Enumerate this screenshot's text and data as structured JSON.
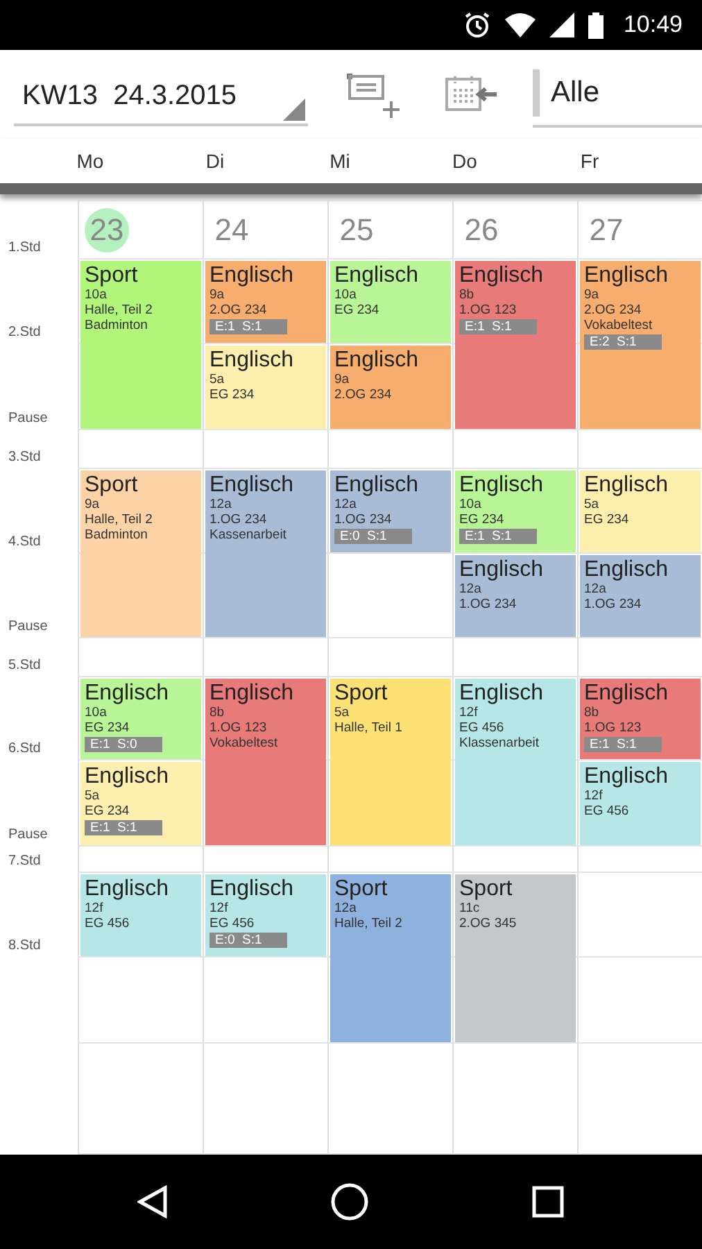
{
  "status_bar": {
    "time": "10:49"
  },
  "toolbar": {
    "week_picker": "KW13  24.3.2015",
    "filter": "Alle"
  },
  "times": [
    "1.Std",
    "2.Std",
    "Pause",
    "3.Std",
    "4.Std",
    "Pause",
    "5.Std",
    "6.Std",
    "Pause",
    "7.Std",
    "8.Std"
  ],
  "days": [
    {
      "weekday": "Mo",
      "date": "23",
      "today": true,
      "slots": [
        {
          "kind": "lesson",
          "subject": "Sport",
          "details": [
            "10a",
            "Halle, Teil 2",
            "Badminton"
          ],
          "color": "#b1f57a"
        },
        {
          "kind": "continued"
        },
        {
          "kind": "lesson",
          "subject": "Sport",
          "details": [
            "9a",
            "Halle, Teil 2",
            "Badminton"
          ],
          "color": "#fbd3a6"
        },
        {
          "kind": "continued"
        },
        {
          "kind": "lesson",
          "subject": "Englisch",
          "details": [
            "10a",
            "EG 234"
          ],
          "badge": "E:1  S:0",
          "color": "#b9f596"
        },
        {
          "kind": "lesson",
          "subject": "Englisch",
          "details": [
            "5a",
            "EG 234"
          ],
          "badge": "E:1  S:1",
          "color": "#fcefad"
        },
        {
          "kind": "lesson",
          "subject": "Englisch",
          "details": [
            "12f",
            "EG 456"
          ],
          "color": "#b6e7e6"
        },
        {
          "kind": "free"
        }
      ]
    },
    {
      "weekday": "Di",
      "date": "24",
      "today": false,
      "slots": [
        {
          "kind": "lesson",
          "subject": "Englisch",
          "details": [
            "9a",
            "2.OG 234"
          ],
          "badge": "E:1  S:1",
          "color": "#f6ad6d"
        },
        {
          "kind": "lesson",
          "subject": "Englisch",
          "details": [
            "5a",
            "EG 234"
          ],
          "color": "#fcefad"
        },
        {
          "kind": "lesson",
          "subject": "Englisch",
          "details": [
            "12a",
            "1.OG 234",
            "Kassenarbeit"
          ],
          "color": "#a8bcd6"
        },
        {
          "kind": "continued"
        },
        {
          "kind": "lesson",
          "subject": "Englisch",
          "details": [
            "8b",
            "1.OG 123",
            "Vokabeltest"
          ],
          "color": "#e87a7a"
        },
        {
          "kind": "continued"
        },
        {
          "kind": "lesson",
          "subject": "Englisch",
          "details": [
            "12f",
            "EG 456"
          ],
          "badge": "E:0  S:1",
          "color": "#b6e7e6"
        },
        {
          "kind": "free"
        }
      ]
    },
    {
      "weekday": "Mi",
      "date": "25",
      "today": false,
      "slots": [
        {
          "kind": "lesson",
          "subject": "Englisch",
          "details": [
            "10a",
            "EG 234"
          ],
          "color": "#b9f596"
        },
        {
          "kind": "lesson",
          "subject": "Englisch",
          "details": [
            "9a",
            "2.OG 234"
          ],
          "color": "#f6ad6d"
        },
        {
          "kind": "lesson",
          "subject": "Englisch",
          "details": [
            "12a",
            "1.OG 234"
          ],
          "badge": "E:0  S:1",
          "color": "#a8bcd6"
        },
        {
          "kind": "free"
        },
        {
          "kind": "lesson",
          "subject": "Sport",
          "details": [
            "5a",
            "Halle, Teil 1"
          ],
          "color": "#fce174"
        },
        {
          "kind": "continued"
        },
        {
          "kind": "lesson",
          "subject": "Sport",
          "details": [
            "12a",
            "Halle, Teil 2"
          ],
          "color": "#8fb1dd"
        },
        {
          "kind": "continued"
        }
      ]
    },
    {
      "weekday": "Do",
      "date": "26",
      "today": false,
      "slots": [
        {
          "kind": "lesson",
          "subject": "Englisch",
          "details": [
            "8b",
            "1.OG 123"
          ],
          "badge": "E:1  S:1",
          "color": "#e87a7a"
        },
        {
          "kind": "continued"
        },
        {
          "kind": "lesson",
          "subject": "Englisch",
          "details": [
            "10a",
            "EG 234"
          ],
          "badge": "E:1  S:1",
          "color": "#b9f596"
        },
        {
          "kind": "lesson",
          "subject": "Englisch",
          "details": [
            "12a",
            "1.OG 234"
          ],
          "color": "#a8bcd6"
        },
        {
          "kind": "lesson",
          "subject": "Englisch",
          "details": [
            "12f",
            "EG 456",
            "Klassenarbeit"
          ],
          "color": "#b6e7e6"
        },
        {
          "kind": "continued"
        },
        {
          "kind": "lesson",
          "subject": "Sport",
          "details": [
            "11c",
            "2.OG 345"
          ],
          "color": "#c4c8cb"
        },
        {
          "kind": "continued"
        }
      ]
    },
    {
      "weekday": "Fr",
      "date": "27",
      "today": false,
      "slots": [
        {
          "kind": "lesson",
          "subject": "Englisch",
          "details": [
            "9a",
            "2.OG 234",
            "Vokabeltest"
          ],
          "badge": "E:2  S:1",
          "color": "#f6ad6d"
        },
        {
          "kind": "continued"
        },
        {
          "kind": "lesson",
          "subject": "Englisch",
          "details": [
            "5a",
            "EG 234"
          ],
          "color": "#fcefad"
        },
        {
          "kind": "lesson",
          "subject": "Englisch",
          "details": [
            "12a",
            "1.OG 234"
          ],
          "color": "#a8bcd6"
        },
        {
          "kind": "lesson",
          "subject": "Englisch",
          "details": [
            "8b",
            "1.OG 123"
          ],
          "badge": "E:1  S:1",
          "color": "#e87a7a"
        },
        {
          "kind": "lesson",
          "subject": "Englisch",
          "details": [
            "12f",
            "EG 456"
          ],
          "color": "#b6e7e6"
        },
        {
          "kind": "free"
        },
        {
          "kind": "free"
        }
      ]
    }
  ]
}
